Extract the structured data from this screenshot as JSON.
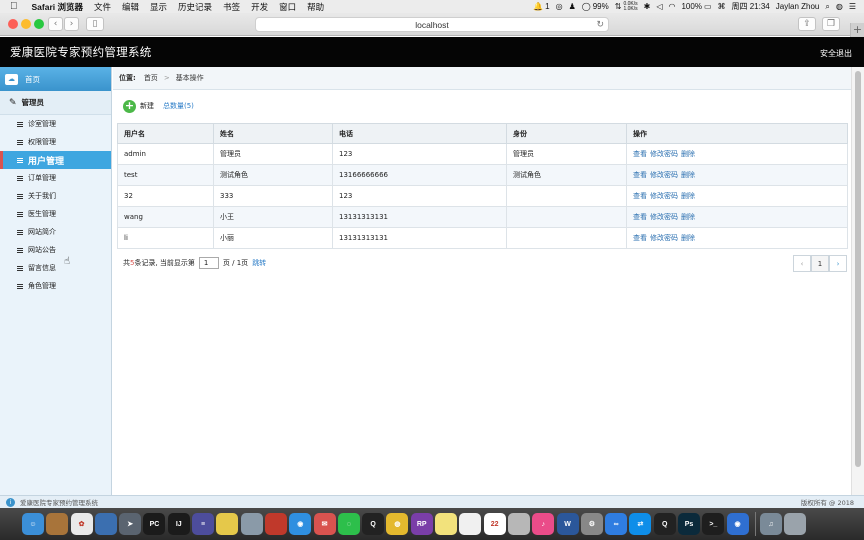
{
  "os_menubar": {
    "app_name": "Safari 浏览器",
    "menus": [
      "文件",
      "编辑",
      "显示",
      "历史记录",
      "书签",
      "开发",
      "窗口",
      "帮助"
    ],
    "notif_count": "1",
    "net_up": "0.0K/s",
    "net_down": "1.0K/s",
    "battery_left": "99%",
    "battery_right": "100%",
    "clock": "周四 21:34",
    "user": "Jaylan Zhou"
  },
  "browser": {
    "url": "localhost"
  },
  "header": {
    "title": "爱康医院专家预约管理系统",
    "logout": "安全退出"
  },
  "sidebar": {
    "home": "首页",
    "group": "管理员",
    "items": [
      {
        "label": "诊室管理"
      },
      {
        "label": "权限管理"
      },
      {
        "label": "用户管理"
      },
      {
        "label": "订单管理"
      },
      {
        "label": "关于我们"
      },
      {
        "label": "医生管理"
      },
      {
        "label": "网站简介"
      },
      {
        "label": "网站公告"
      },
      {
        "label": "留言信息"
      },
      {
        "label": "角色管理"
      }
    ]
  },
  "breadcrumb": {
    "label": "位置:",
    "home": "首页",
    "sep": ">",
    "current": "基本操作"
  },
  "actions": {
    "new_label": "新建",
    "total_label": "总数量(5)"
  },
  "table": {
    "headers": [
      "用户名",
      "姓名",
      "电话",
      "身份",
      "操作"
    ],
    "rows": [
      {
        "username": "admin",
        "name": "管理员",
        "phone": "123",
        "role": "管理员"
      },
      {
        "username": "test",
        "name": "测试角色",
        "phone": "13166666666",
        "role": "测试角色"
      },
      {
        "username": "32",
        "name": "333",
        "phone": "123",
        "role": ""
      },
      {
        "username": "wang",
        "name": "小王",
        "phone": "13131313131",
        "role": ""
      },
      {
        "username": "li",
        "name": "小丽",
        "phone": "13131313131",
        "role": ""
      }
    ],
    "op_view": "查看",
    "op_password": "修改密码",
    "op_delete": "删除"
  },
  "pager": {
    "prefix": "共",
    "total": "5",
    "mid": "条记录,  当前显示第",
    "page_value": "1",
    "suffix": "页 / 1页",
    "jump": "跳转",
    "prev": "‹",
    "current": "1",
    "next": "›"
  },
  "footer": {
    "info_icon": "i",
    "text": "爱康医院专家预约管理系统",
    "copyright": "版权所有 @ 2018"
  },
  "dock_apps": [
    {
      "name": "finder",
      "color": "#3b8fd8",
      "glyph": "☺"
    },
    {
      "name": "notefile",
      "color": "#a8743a",
      "glyph": ""
    },
    {
      "name": "photos",
      "color": "#e9e9e9",
      "glyph": "✿"
    },
    {
      "name": "preview",
      "color": "#3b6fb0",
      "glyph": ""
    },
    {
      "name": "launchpad",
      "color": "#5a6470",
      "glyph": "➤"
    },
    {
      "name": "pycharm",
      "color": "#1b1b1b",
      "glyph": "PC"
    },
    {
      "name": "intellij",
      "color": "#1b1b1b",
      "glyph": "IJ"
    },
    {
      "name": "vmware",
      "color": "#4d4d9c",
      "glyph": "≡"
    },
    {
      "name": "cyberduck",
      "color": "#e5c84a",
      "glyph": ""
    },
    {
      "name": "db-tool",
      "color": "#8a9aa8",
      "glyph": ""
    },
    {
      "name": "redis",
      "color": "#c0392b",
      "glyph": ""
    },
    {
      "name": "safari",
      "color": "#2f8fe0",
      "glyph": "◉"
    },
    {
      "name": "mail",
      "color": "#d9534f",
      "glyph": "✉"
    },
    {
      "name": "wechat",
      "color": "#2dbf4b",
      "glyph": "◌"
    },
    {
      "name": "qq",
      "color": "#222222",
      "glyph": "Q"
    },
    {
      "name": "coin",
      "color": "#e4b92e",
      "glyph": "◍"
    },
    {
      "name": "axure-rp",
      "color": "#7a3ea8",
      "glyph": "RP"
    },
    {
      "name": "notes",
      "color": "#f2e27c",
      "glyph": ""
    },
    {
      "name": "stickies",
      "color": "#f0f0f0",
      "glyph": ""
    },
    {
      "name": "calendar",
      "color": "#ffffff",
      "glyph": "22"
    },
    {
      "name": "contacts",
      "color": "#b7b7b7",
      "glyph": ""
    },
    {
      "name": "itunes",
      "color": "#ea4c89",
      "glyph": "♪"
    },
    {
      "name": "word",
      "color": "#2b579a",
      "glyph": "W"
    },
    {
      "name": "system-prefs",
      "color": "#888888",
      "glyph": "⚙"
    },
    {
      "name": "baidu-pan",
      "color": "#2f7de1",
      "glyph": "∞"
    },
    {
      "name": "teamviewer",
      "color": "#0e8ee9",
      "glyph": "⇄"
    },
    {
      "name": "penguin",
      "color": "#222222",
      "glyph": "Q"
    },
    {
      "name": "photoshop",
      "color": "#0b2a3b",
      "glyph": "Ps"
    },
    {
      "name": "terminal",
      "color": "#1e1e1e",
      "glyph": ">_"
    },
    {
      "name": "chrome",
      "color": "#2f6fd1",
      "glyph": "◉"
    },
    {
      "name": "music-folder",
      "color": "#7a8a98",
      "glyph": "♫"
    },
    {
      "name": "trash",
      "color": "#9aa3ab",
      "glyph": ""
    }
  ]
}
